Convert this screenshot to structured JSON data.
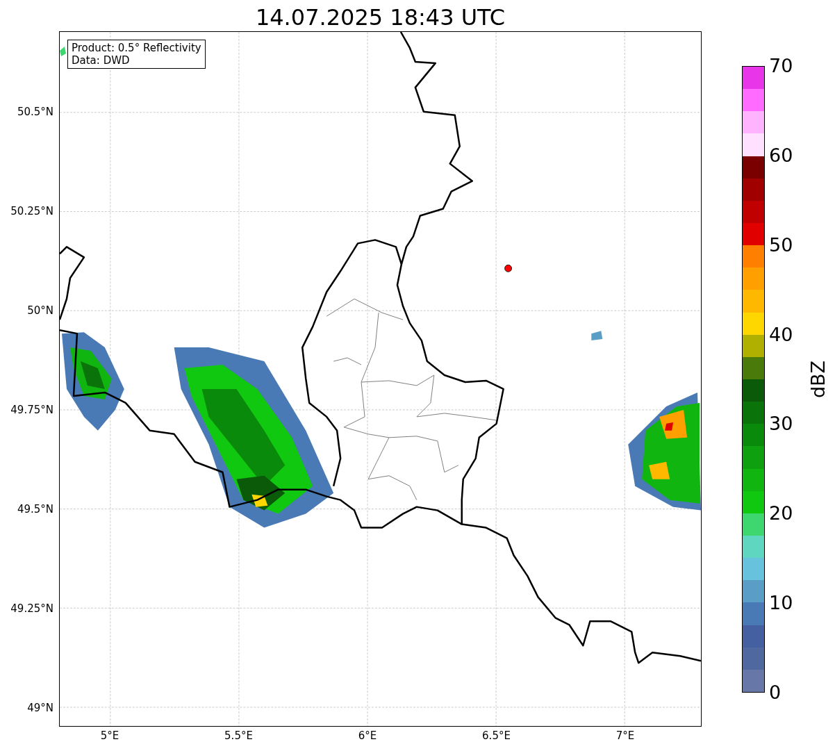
{
  "title": "14.07.2025 18:43 UTC",
  "map": {
    "info_box": [
      "Product: 0.5° Reflectivity",
      "Data: DWD"
    ],
    "lat_ticks": [
      "50.5°N",
      "50.25°N",
      "50°N",
      "49.75°N",
      "49.5°N",
      "49.25°N",
      "49°N"
    ],
    "lon_ticks": [
      "5°E",
      "5.5°E",
      "6°E",
      "6.5°E",
      "7°E"
    ]
  },
  "colorbar": {
    "label": "dBZ",
    "ticks": [
      "70",
      "60",
      "50",
      "40",
      "30",
      "20",
      "10",
      "0"
    ],
    "segments": [
      {
        "color": "#e935e9"
      },
      {
        "color": "#ff6bff"
      },
      {
        "color": "#ffb3ff"
      },
      {
        "color": "#ffe0ff"
      },
      {
        "color": "#7a0000"
      },
      {
        "color": "#a00000"
      },
      {
        "color": "#c00000"
      },
      {
        "color": "#e00000"
      },
      {
        "color": "#ff7f00"
      },
      {
        "color": "#ff9f00"
      },
      {
        "color": "#ffb800"
      },
      {
        "color": "#ffd700"
      },
      {
        "color": "#b0b000"
      },
      {
        "color": "#4a7a0a"
      },
      {
        "color": "#0a5a0a"
      },
      {
        "color": "#0a730a"
      },
      {
        "color": "#0a8a0a"
      },
      {
        "color": "#0fa00f"
      },
      {
        "color": "#10b510"
      },
      {
        "color": "#10c810"
      },
      {
        "color": "#3ed66e"
      },
      {
        "color": "#5ed6c0"
      },
      {
        "color": "#66c2dd"
      },
      {
        "color": "#5a9ec8"
      },
      {
        "color": "#4a7ab5"
      },
      {
        "color": "#4460a0"
      },
      {
        "color": "#5068a0"
      },
      {
        "color": "#6677a8"
      }
    ]
  }
}
